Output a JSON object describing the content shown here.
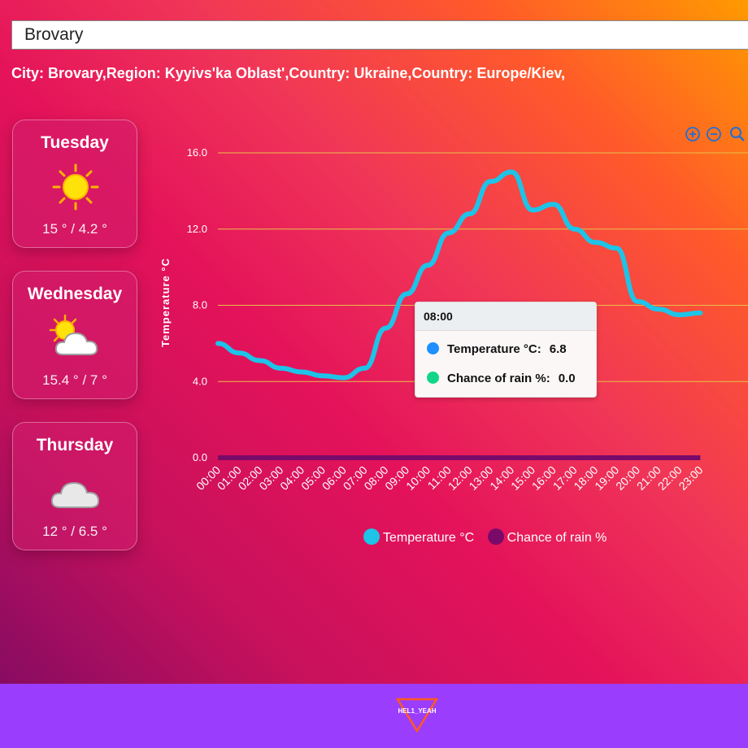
{
  "search": {
    "value": "Brovary"
  },
  "location_line": "City: Brovary,Region: Kyyivs'ka Oblast',Country: Ukraine,Country: Europe/Kiev,",
  "forecast": [
    {
      "day": "Tuesday",
      "temps": "15 ° / 4.2 °",
      "icon": "sun-icon"
    },
    {
      "day": "Wednesday",
      "temps": "15.4 ° / 7 °",
      "icon": "partly-cloudy-icon"
    },
    {
      "day": "Thursday",
      "temps": "12 ° / 6.5 °",
      "icon": "cloud-icon"
    }
  ],
  "toolbar": {
    "icons": [
      "zoom-in-icon",
      "zoom-out-icon",
      "zoom-search-icon"
    ]
  },
  "chart_data": {
    "type": "line",
    "ylabel": "Temperature °C",
    "ylim": [
      0,
      16
    ],
    "yticks": [
      "16.0",
      "12.0",
      "8.0",
      "4.0",
      "0.0"
    ],
    "x": [
      "00:00",
      "01:00",
      "02:00",
      "03:00",
      "04:00",
      "05:00",
      "06:00",
      "07:00",
      "08:00",
      "09:00",
      "10:00",
      "11:00",
      "12:00",
      "13:00",
      "14:00",
      "15:00",
      "16:00",
      "17:00",
      "18:00",
      "19:00",
      "20:00",
      "21:00",
      "22:00",
      "23:00"
    ],
    "series": [
      {
        "name": "Temperature °C",
        "color": "#1ec3e8",
        "values": [
          6.0,
          5.5,
          5.1,
          4.7,
          4.5,
          4.3,
          4.2,
          4.7,
          6.8,
          8.6,
          10.1,
          11.8,
          12.8,
          14.5,
          15.0,
          13.0,
          13.3,
          12.0,
          11.3,
          11.0,
          8.2,
          7.8,
          7.5,
          7.6
        ]
      },
      {
        "name": "Chance of rain %",
        "color": "#7a0a6a",
        "values": [
          0,
          0,
          0,
          0,
          0,
          0,
          0,
          0,
          0,
          0,
          0,
          0,
          0,
          0,
          0,
          0,
          0,
          0,
          0,
          0,
          0,
          0,
          0,
          0
        ]
      }
    ],
    "legend": "bottom",
    "grid": true
  },
  "tooltip": {
    "title": "08:00",
    "rows": [
      {
        "label": "Temperature °C:",
        "value": "6.8",
        "color": "#1e90ff"
      },
      {
        "label": "Chance of rain %:",
        "value": "0.0",
        "color": "#11d68a"
      }
    ]
  },
  "footer": {
    "logo_text": "HEL1_YEAH"
  }
}
